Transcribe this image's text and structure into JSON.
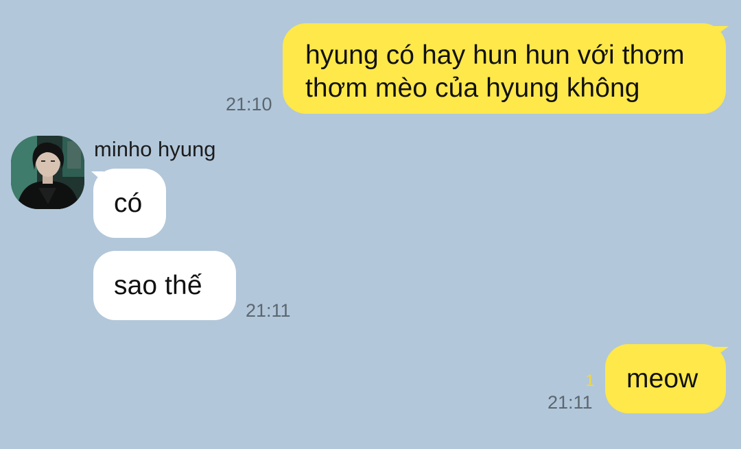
{
  "messages": [
    {
      "from": "me",
      "text": "hyung có hay hun hun với thơm thơm mèo của hyung không",
      "time": "21:10"
    },
    {
      "from": "minho hyung",
      "text": "có"
    },
    {
      "from": "minho hyung",
      "text": "sao thế",
      "time": "21:11"
    },
    {
      "from": "me",
      "text": "meow",
      "time": "21:11",
      "unread": "1"
    }
  ],
  "contact": {
    "name": "minho hyung",
    "avatar_icon": "profile-photo-avatar"
  },
  "colors": {
    "background": "#b2c7da",
    "my_bubble": "#fee84a",
    "their_bubble": "#ffffff",
    "unread_count": "#f2d83b",
    "timestamp": "#5b6670"
  }
}
